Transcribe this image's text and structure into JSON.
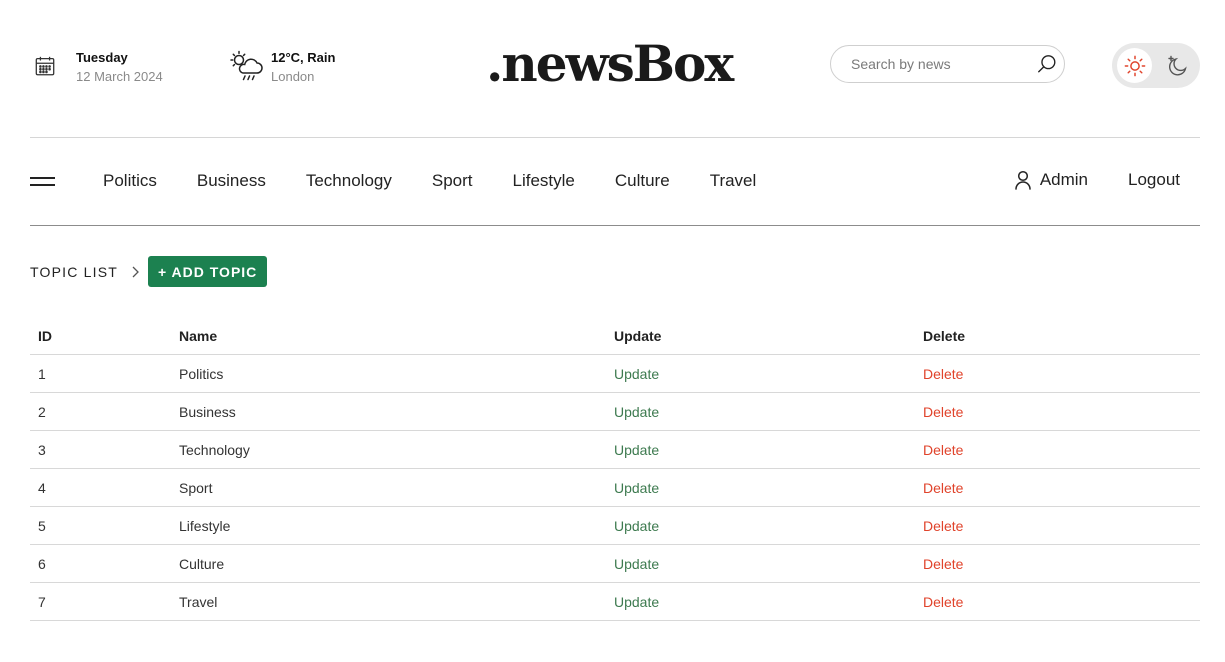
{
  "header": {
    "date": {
      "icon": "calendar-icon",
      "day": "Tuesday",
      "date": "12 March 2024"
    },
    "weather": {
      "icon": "weather-rain-icon",
      "condition": "12°C, Rain",
      "location": "London"
    },
    "logo": ".newsBox",
    "search": {
      "placeholder": "Search by news",
      "value": "",
      "icon": "search-icon"
    },
    "theme_toggle": {
      "light_icon": "sun-icon",
      "dark_icon": "moon-icon",
      "active": "light",
      "accent_color": "#e0432b"
    }
  },
  "nav": {
    "menu_icon": "hamburger-icon",
    "links": [
      "Politics",
      "Business",
      "Technology",
      "Sport",
      "Lifestyle",
      "Culture",
      "Travel"
    ],
    "admin": {
      "icon": "user-icon",
      "label": "Admin"
    },
    "logout": "Logout"
  },
  "content": {
    "breadcrumb_title": "TOPIC LIST",
    "breadcrumb_icon": "chevron-right-icon",
    "add_button": "+ ADD TOPIC",
    "add_button_color": "#1c8150",
    "table": {
      "headers": [
        "ID",
        "Name",
        "Update",
        "Delete"
      ],
      "rows": [
        {
          "id": "1",
          "name": "Politics",
          "update": "Update",
          "delete": "Delete"
        },
        {
          "id": "2",
          "name": "Business",
          "update": "Update",
          "delete": "Delete"
        },
        {
          "id": "3",
          "name": "Technology",
          "update": "Update",
          "delete": "Delete"
        },
        {
          "id": "4",
          "name": "Sport",
          "update": "Update",
          "delete": "Delete"
        },
        {
          "id": "5",
          "name": "Lifestyle",
          "update": "Update",
          "delete": "Delete"
        },
        {
          "id": "6",
          "name": "Culture",
          "update": "Update",
          "delete": "Delete"
        },
        {
          "id": "7",
          "name": "Travel",
          "update": "Update",
          "delete": "Delete"
        }
      ],
      "update_color": "#3d7a4f",
      "delete_color": "#e0432b"
    }
  }
}
